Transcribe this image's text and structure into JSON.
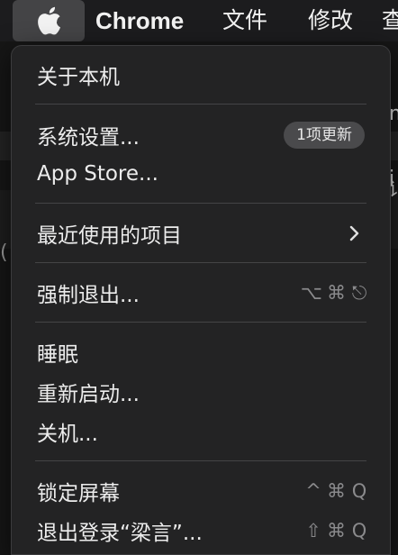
{
  "menubar": {
    "apple_icon": "apple-logo-icon",
    "app_name": "Chrome",
    "items": [
      "文件",
      "修改",
      "查"
    ]
  },
  "background": {
    "snippets": [
      "m",
      "i",
      "讠",
      "("
    ]
  },
  "apple_menu": {
    "about": "关于本机",
    "system_settings": "系统设置...",
    "update_badge": "1项更新",
    "app_store": "App Store...",
    "recent_items": "最近使用的项目",
    "force_quit": "强制退出...",
    "force_quit_shortcut": [
      "⌥",
      "⌘",
      "⎋"
    ],
    "sleep": "睡眠",
    "restart": "重新启动...",
    "shutdown": "关机...",
    "lock_screen": "锁定屏幕",
    "lock_shortcut": [
      "^",
      "⌘",
      "Q"
    ],
    "logout": "退出登录“梁言”...",
    "logout_shortcut": [
      "⇧",
      "⌘",
      "Q"
    ]
  }
}
